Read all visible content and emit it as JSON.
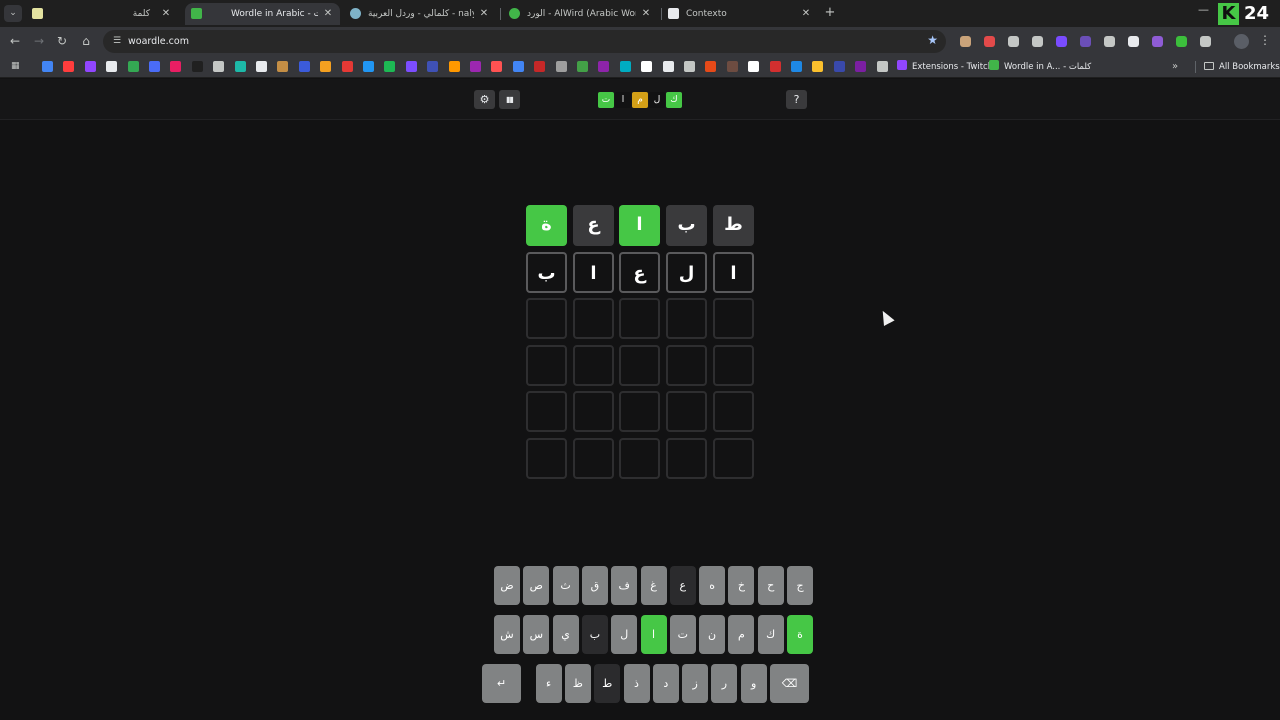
{
  "browser": {
    "tabs": [
      {
        "title": "كلمة",
        "favicon_color": "#e3e2a0"
      },
      {
        "title": "Wordle in Arabic - كلمات",
        "favicon_color": "#41b549",
        "active": true
      },
      {
        "title": "كلمالي - وردل العربية - naly.com",
        "favicon_color": "#7fb3c8"
      },
      {
        "title": "الورد - AlWird (Arabic Wordle)",
        "favicon_color": "#41b549"
      },
      {
        "title": "Contexto",
        "favicon_color": "#e8eaed"
      }
    ],
    "url": "woardle.com",
    "brand_badge": {
      "letter": "K",
      "number": "24"
    },
    "bookmarks": [
      {
        "label": "Extensions - Twitch",
        "color": "#9146ff"
      },
      {
        "label": "Wordle in A... - كلمات",
        "color": "#41b549"
      }
    ],
    "all_bookmarks_label": "All Bookmarks",
    "extension_colors": [
      "#c9a37a",
      "#e34a4a",
      "#c4c7c5",
      "#c4c7c5",
      "#7a4cff",
      "#6b4fb8",
      "#c4c7c5",
      "#e8eaed",
      "#8f5cd6",
      "#3cbf3c",
      "#c4c7c5"
    ],
    "bookmark_colors": [
      "#4285f4",
      "#ff3d3d",
      "#9146ff",
      "#e8eaed",
      "#34a853",
      "#4a6cf7",
      "#e91e63",
      "#202020",
      "#c4c7c5",
      "#1db9a8",
      "#e8eaed",
      "#c48e45",
      "#3b5bdb",
      "#f4a020",
      "#e53935",
      "#2196f3",
      "#1db954",
      "#7c4dff",
      "#3f51b5",
      "#ff9800",
      "#9c27b0",
      "#ff5252",
      "#4285f4",
      "#c62828",
      "#9e9e9e",
      "#43a047",
      "#8e24aa",
      "#00acc1",
      "#ffffff",
      "#e8eaed",
      "#c4c7c5",
      "#e64a19",
      "#6d4c41",
      "#ffffff",
      "#d32f2f",
      "#1e88e5",
      "#fbc02d",
      "#3949ab",
      "#7b1fa2",
      "#c4c7c5"
    ]
  },
  "header": {
    "logo": [
      "ت",
      "ا",
      "م",
      "ل",
      "ك"
    ],
    "logo_colors": [
      "#46c746",
      "#121213",
      "#d4a017",
      "#121213",
      "#46c746"
    ],
    "settings_icon": "⚙",
    "stats_icon": "▮▮",
    "help_icon": "?"
  },
  "board": {
    "rows": [
      {
        "cells": [
          {
            "letter": "ط",
            "state": "absent"
          },
          {
            "letter": "ب",
            "state": "absent"
          },
          {
            "letter": "ا",
            "state": "correct"
          },
          {
            "letter": "ع",
            "state": "absent"
          },
          {
            "letter": "ة",
            "state": "correct"
          }
        ]
      },
      {
        "cells": [
          {
            "letter": "ا",
            "state": "filled"
          },
          {
            "letter": "ل",
            "state": "filled"
          },
          {
            "letter": "ع",
            "state": "filled"
          },
          {
            "letter": "ا",
            "state": "filled"
          },
          {
            "letter": "ب",
            "state": "filled"
          }
        ]
      },
      {
        "cells": [
          {
            "letter": "",
            "state": "empty"
          },
          {
            "letter": "",
            "state": "empty"
          },
          {
            "letter": "",
            "state": "empty"
          },
          {
            "letter": "",
            "state": "empty"
          },
          {
            "letter": "",
            "state": "empty"
          }
        ]
      },
      {
        "cells": [
          {
            "letter": "",
            "state": "empty"
          },
          {
            "letter": "",
            "state": "empty"
          },
          {
            "letter": "",
            "state": "empty"
          },
          {
            "letter": "",
            "state": "empty"
          },
          {
            "letter": "",
            "state": "empty"
          }
        ]
      },
      {
        "cells": [
          {
            "letter": "",
            "state": "empty"
          },
          {
            "letter": "",
            "state": "empty"
          },
          {
            "letter": "",
            "state": "empty"
          },
          {
            "letter": "",
            "state": "empty"
          },
          {
            "letter": "",
            "state": "empty"
          }
        ]
      },
      {
        "cells": [
          {
            "letter": "",
            "state": "empty"
          },
          {
            "letter": "",
            "state": "empty"
          },
          {
            "letter": "",
            "state": "empty"
          },
          {
            "letter": "",
            "state": "empty"
          },
          {
            "letter": "",
            "state": "empty"
          }
        ]
      }
    ]
  },
  "keyboard": {
    "rows": [
      [
        {
          "k": "ج"
        },
        {
          "k": "ح"
        },
        {
          "k": "خ"
        },
        {
          "k": "ه"
        },
        {
          "k": "ع",
          "state": "absent"
        },
        {
          "k": "غ"
        },
        {
          "k": "ف"
        },
        {
          "k": "ق"
        },
        {
          "k": "ث"
        },
        {
          "k": "ص"
        },
        {
          "k": "ض"
        }
      ],
      [
        {
          "k": "ة",
          "state": "correct"
        },
        {
          "k": "ك"
        },
        {
          "k": "م"
        },
        {
          "k": "ن"
        },
        {
          "k": "ت"
        },
        {
          "k": "ا",
          "state": "correct"
        },
        {
          "k": "ل"
        },
        {
          "k": "ب",
          "state": "absent"
        },
        {
          "k": "ي"
        },
        {
          "k": "س"
        },
        {
          "k": "ش"
        }
      ],
      [
        {
          "k": "⌫",
          "wide": true
        },
        {
          "k": "و"
        },
        {
          "k": "ر"
        },
        {
          "k": "ز"
        },
        {
          "k": "د"
        },
        {
          "k": "ذ"
        },
        {
          "k": "ط",
          "state": "absent"
        },
        {
          "k": "ظ"
        },
        {
          "k": "ء"
        },
        {
          "k": "↵",
          "wide": true
        }
      ]
    ]
  }
}
